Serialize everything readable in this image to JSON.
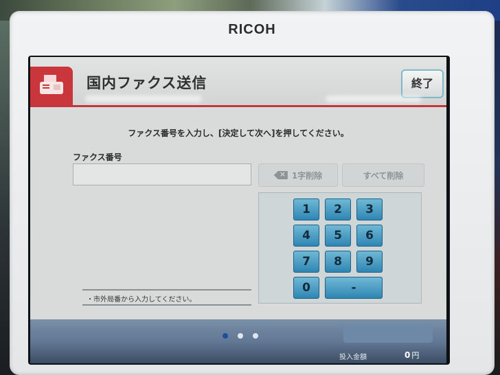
{
  "device": {
    "brand": "RICOH"
  },
  "header": {
    "title": "国内ファクス送信",
    "end_label": "終了"
  },
  "instruction": "ファクス番号を入力し、[決定して次へ]を押してください。",
  "fax_field": {
    "label": "ファクス番号",
    "value": ""
  },
  "buttons": {
    "delete_one": "1字削除",
    "delete_all": "すべて削除"
  },
  "keypad": {
    "keys": [
      "1",
      "2",
      "3",
      "4",
      "5",
      "6",
      "7",
      "8",
      "9",
      "0",
      "-"
    ]
  },
  "note": "・市外局番から入力してください。",
  "pagination": {
    "total_pages": 3,
    "current_page": 1
  },
  "footer": {
    "amount_label": "投入金額",
    "amount_value": "0",
    "amount_unit": "円"
  },
  "colors": {
    "accent_red": "#c9373d",
    "key_blue": "#2f86b3",
    "footer_blue": "#5f7591",
    "dot_active": "#1d4f9c",
    "dot_inactive": "#dfe6ee"
  },
  "icons": {
    "header": "fax-machine-icon",
    "backspace": "backspace-icon"
  }
}
